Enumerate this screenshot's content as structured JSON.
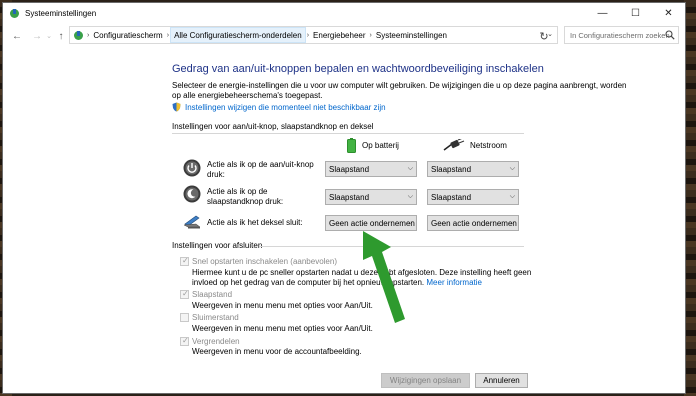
{
  "window": {
    "title": "Systeeminstellingen",
    "controls": [
      "—",
      "☐",
      "✕"
    ]
  },
  "nav": {
    "back": "←",
    "forward": "→",
    "recent": "⌄",
    "up": "↑"
  },
  "address": {
    "crumbs": [
      "Configuratiescherm",
      "Alle Configuratiescherm-onderdelen",
      "Energiebeheer",
      "Systeeminstellingen"
    ],
    "separator": "›",
    "dropdown": "⌄",
    "refresh": "↻"
  },
  "search": {
    "placeholder": "In Configuratiescherm zoeken"
  },
  "page": {
    "heading": "Gedrag van aan/uit-knoppen bepalen en wachtwoordbeveiliging inschakelen",
    "intro": "Selecteer de energie-instellingen die u voor uw computer wilt gebruiken. De wijzigingen die u op deze pagina aanbrengt, worden op alle energiebeheerschema's toegepast.",
    "unavailable_link": "Instellingen wijzigen die momenteel niet beschikbaar zijn"
  },
  "buttons_section": {
    "title": "Instellingen voor aan/uit-knop, slaapstandknop en deksel",
    "col_battery": "Op batterij",
    "col_ac": "Netstroom",
    "rows": [
      {
        "label": "Actie als ik op de aan/uit-knop druk:",
        "battery": "Slaapstand",
        "ac": "Slaapstand"
      },
      {
        "label": "Actie als ik op de slaapstandknop druk:",
        "battery": "Slaapstand",
        "ac": "Slaapstand"
      },
      {
        "label": "Actie als ik het deksel sluit:",
        "battery": "Geen actie ondernemen",
        "ac": "Geen actie ondernemen"
      }
    ],
    "chevron": "⌵"
  },
  "shutdown_section": {
    "title": "Instellingen voor afsluiten",
    "options": [
      {
        "label": "Snel opstarten inschakelen (aanbevolen)",
        "checked": true,
        "desc": "Hiermee kunt u de pc sneller opstarten nadat u deze hebt afgesloten. Deze instelling heeft geen invloed op het gedrag van de computer bij het opnieuw opstarten.",
        "link": "Meer informatie"
      },
      {
        "label": "Slaapstand",
        "checked": true,
        "desc": "Weergeven in menu menu met opties voor Aan/Uit."
      },
      {
        "label": "Sluimerstand",
        "checked": false,
        "desc": "Weergeven in menu menu met opties voor Aan/Uit."
      },
      {
        "label": "Vergrendelen",
        "checked": true,
        "desc": "Weergeven in menu voor de accountafbeelding."
      }
    ],
    "tick": "✓"
  },
  "footer": {
    "save": "Wijzigingen opslaan",
    "cancel": "Annuleren"
  },
  "colors": {
    "heading": "#1e3287",
    "link": "#0066cc",
    "annotation_arrow": "#2e9a2e"
  }
}
